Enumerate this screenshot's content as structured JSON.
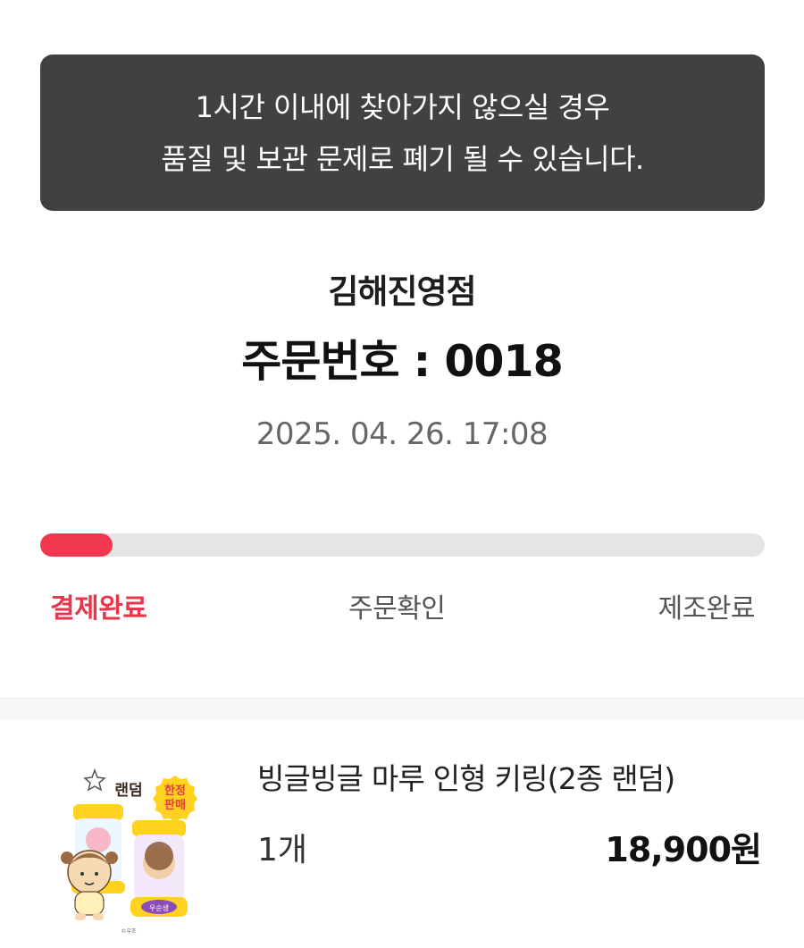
{
  "notice": {
    "line1": "1시간 이내에 찾아가지 않으실 경우",
    "line2": "품질 및 보관 문제로 폐기 될 수 있습니다."
  },
  "order": {
    "store_name": "김해진영점",
    "order_number_text": "주문번호 : 0018",
    "datetime": "2025. 04. 26. 17:08"
  },
  "progress": {
    "fraction": 0.1,
    "steps": [
      {
        "label": "결제완료",
        "active": true
      },
      {
        "label": "주문확인",
        "active": false
      },
      {
        "label": "제조완료",
        "active": false
      }
    ],
    "active_color": "#f2384f"
  },
  "item": {
    "name": "빙글빙글 마루 인형 키링(2종 랜덤)",
    "quantity": "1개",
    "price": "18,900원",
    "image_badge_random": "랜덤",
    "image_badge_limited_1": "한정",
    "image_badge_limited_2": "판매",
    "image_capsule_label": "우순생",
    "image_copyright": "©우조"
  }
}
